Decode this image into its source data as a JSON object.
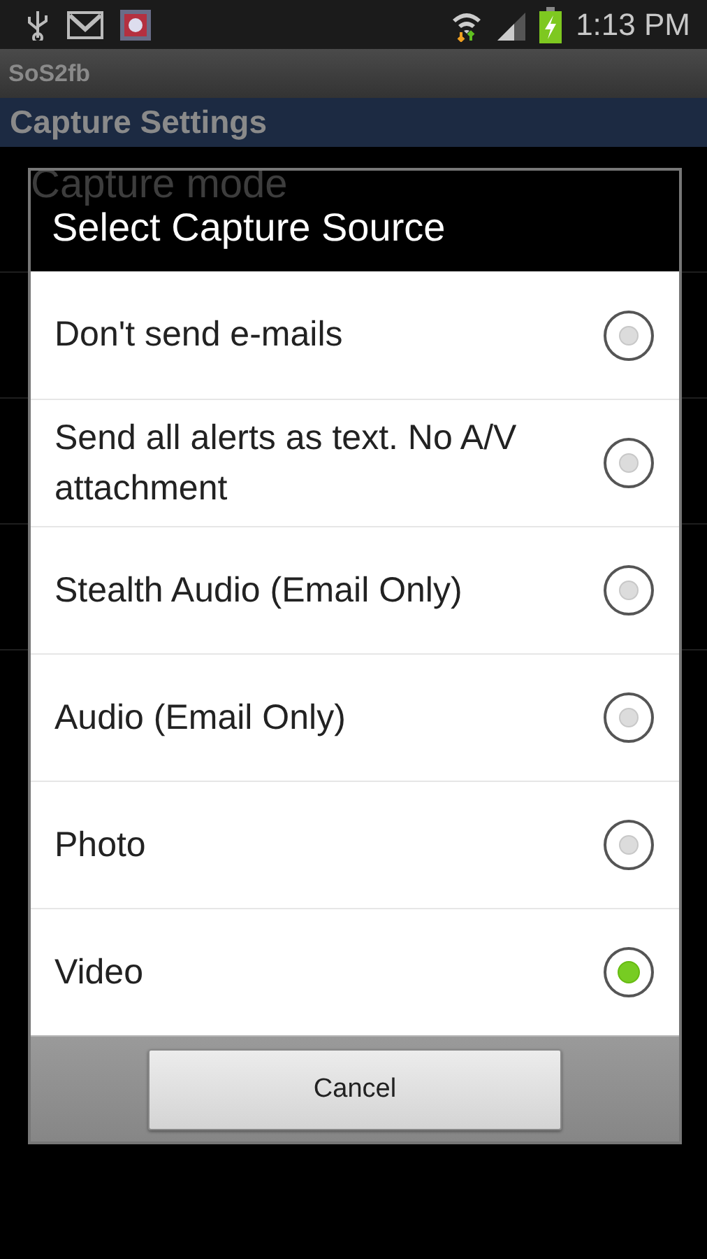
{
  "status_bar": {
    "time": "1:13 PM"
  },
  "app_title": "SoS2fb",
  "screen_title": "Capture Settings",
  "background_list": [
    {
      "title": "Capture mode"
    }
  ],
  "dialog": {
    "title": "Select Capture Source",
    "options": [
      {
        "label": "Don't send e-mails",
        "selected": false
      },
      {
        "label": "Send all alerts as text. No A/V attachment",
        "selected": false
      },
      {
        "label": "Stealth Audio (Email Only)",
        "selected": false
      },
      {
        "label": "Audio (Email Only)",
        "selected": false
      },
      {
        "label": "Photo",
        "selected": false
      },
      {
        "label": "Video",
        "selected": true
      }
    ],
    "buttons": [
      "Cancel"
    ]
  }
}
